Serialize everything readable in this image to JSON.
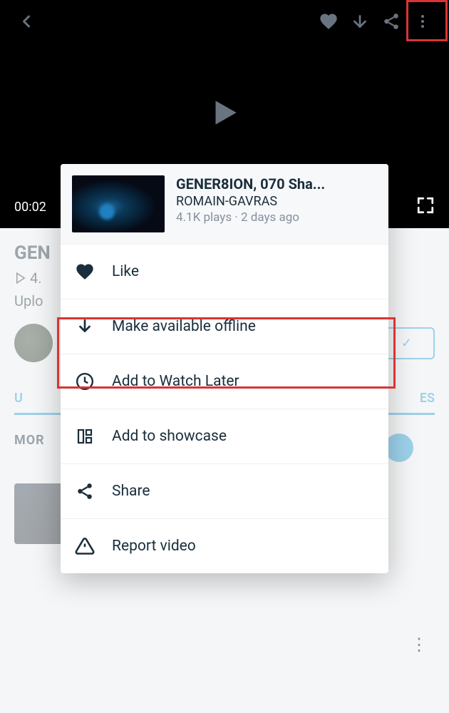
{
  "player": {
    "current_time": "00:02"
  },
  "page": {
    "title": "GEN",
    "stats": "4.",
    "upload": "Uplo",
    "tabs": {
      "left": "U",
      "right": "ES"
    },
    "section": "MOR"
  },
  "sheet": {
    "title": "GENER8ION, 070 Sha...",
    "author": "ROMAIN-GAVRAS",
    "meta": "4.1K plays · 2 days ago"
  },
  "menu": {
    "like": "Like",
    "offline": "Make available offline",
    "later": "Add to Watch Later",
    "showcase": "Add to showcase",
    "share": "Share",
    "report": "Report video"
  }
}
